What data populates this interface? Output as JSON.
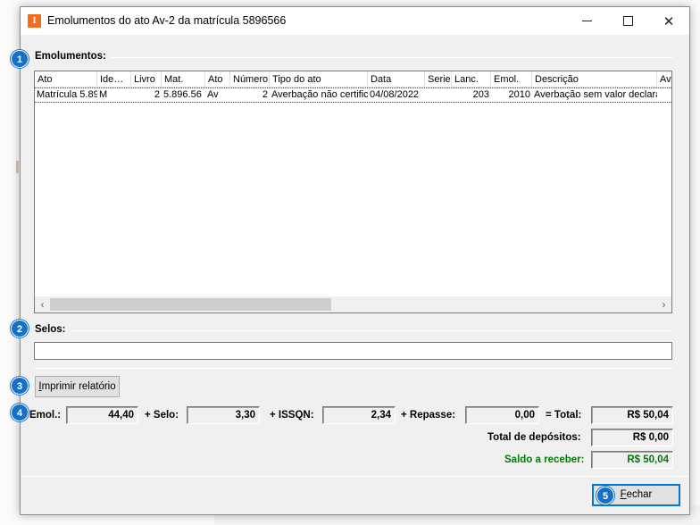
{
  "window": {
    "title": "Emolumentos do ato Av-2 da matrícula 5896566",
    "app_icon_letter": "I",
    "app_icon_color": "#f26d21"
  },
  "badges": [
    "1",
    "2",
    "3",
    "4",
    "5"
  ],
  "emolumentos": {
    "label": "Emolumentos:",
    "columns": [
      "Ato",
      "Ide…",
      "Livro",
      "Mat.",
      "Ato",
      "Número",
      "Tipo do ato",
      "Data",
      "Serie",
      "Lanc.",
      "Emol.",
      "Descrição",
      "Ava"
    ],
    "rows": [
      [
        "Matrícula 5.89",
        "M",
        "2",
        "5.896.56",
        "Av",
        "2",
        "Averbação não certific",
        "04/08/2022",
        "",
        "203",
        "2010",
        "Averbação sem valor declara",
        ""
      ]
    ]
  },
  "selos": {
    "label": "Selos:",
    "value": ""
  },
  "print_button": {
    "label": "Imprimir relatório",
    "mnemonic": "I",
    "rest": "mprimir relatório"
  },
  "totals": {
    "emol_label": "Emol.:",
    "emol_value": "44,40",
    "selo_label": "+ Selo:",
    "selo_value": "3,30",
    "issqn_label": "+ ISSQN:",
    "issqn_value": "2,34",
    "repasse_label": "+ Repasse:",
    "repasse_value": "0,00",
    "total_label": "= Total:",
    "total_value": "R$ 50,04",
    "depositos_label": "Total de depósitos:",
    "depositos_value": "R$ 0,00",
    "saldo_label": "Saldo a receber:",
    "saldo_value": "R$ 50,04",
    "saldo_color": "#007a00"
  },
  "close_button": {
    "label": "Fechar",
    "mnemonic": "F",
    "rest": "echar"
  },
  "accent_color": "#1570c9"
}
